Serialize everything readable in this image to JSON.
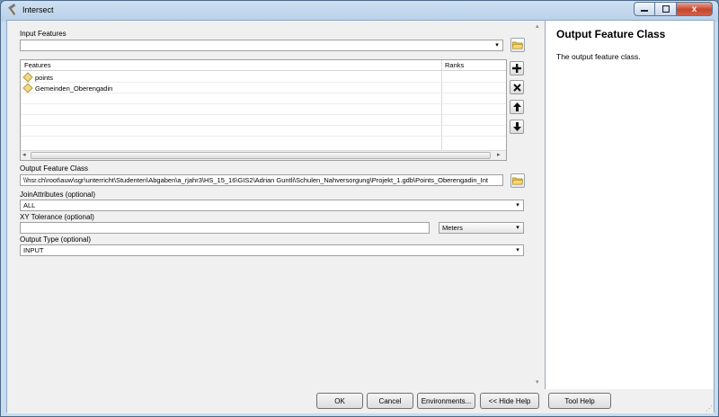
{
  "window": {
    "title": "Intersect",
    "close_glyph": "x"
  },
  "form": {
    "input_features_label": "Input Features",
    "input_features_value": "",
    "table": {
      "columns": [
        "Features",
        "Ranks"
      ],
      "rows": [
        {
          "feature": "points",
          "rank": ""
        },
        {
          "feature": "Gemeinden_Oberengadin",
          "rank": ""
        }
      ]
    },
    "output_feature_class_label": "Output Feature Class",
    "output_feature_class_value": "\\\\hsr.ch\\root\\auw\\sgr\\unterricht\\Studenten\\Abgaben\\a_rjahr3\\HS_15_16\\GIS2\\Adrian Guntli\\Schulen_Nahversorgung\\Projekt_1.gdb\\Points_Oberengadin_Int",
    "join_attributes_label": "JoinAttributes (optional)",
    "join_attributes_value": "ALL",
    "xy_tolerance_label": "XY Tolerance (optional)",
    "xy_tolerance_value": "",
    "xy_tolerance_unit": "Meters",
    "output_type_label": "Output Type (optional)",
    "output_type_value": "INPUT"
  },
  "help": {
    "title": "Output Feature Class",
    "text": "The output feature class."
  },
  "buttons": {
    "ok": "OK",
    "cancel": "Cancel",
    "environments": "Environments...",
    "hide_help": "<< Hide Help",
    "tool_help": "Tool Help"
  },
  "icons": {
    "title_icon": "hammer-icon",
    "folder_icon": "open-folder-icon",
    "add_icon": "plus-icon",
    "remove_icon": "x-icon",
    "up_icon": "arrow-up-icon",
    "down_icon": "arrow-down-icon"
  }
}
